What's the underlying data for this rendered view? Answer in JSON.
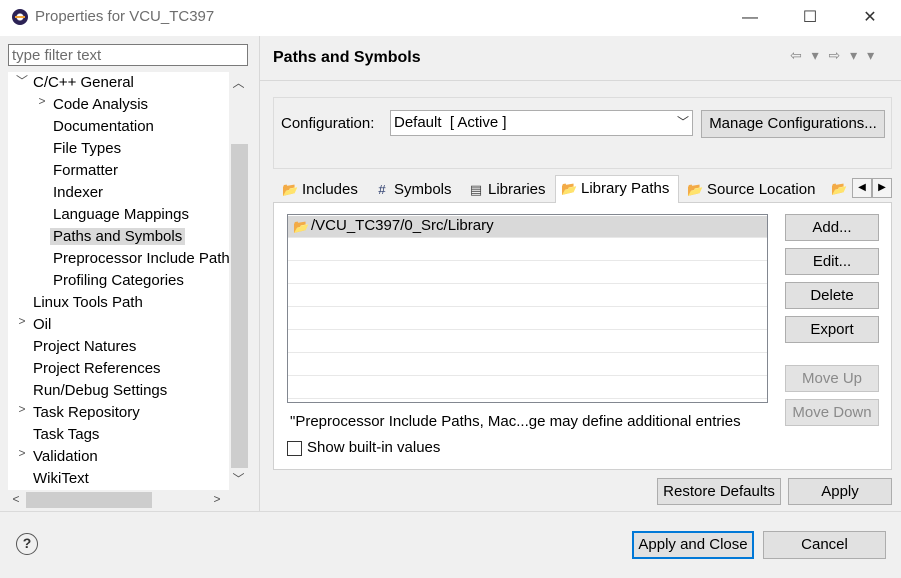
{
  "window": {
    "title": "Properties for VCU_TC397",
    "minimize_icon": "—",
    "maximize_icon": "☐",
    "close_icon": "✕"
  },
  "filter": {
    "placeholder": "type filter text",
    "value": ""
  },
  "tree": {
    "items": [
      {
        "label": "C/C++ General",
        "level": 1,
        "expander": "expanded"
      },
      {
        "label": "Code Analysis",
        "level": 2,
        "expander": "collapsed"
      },
      {
        "label": "Documentation",
        "level": 2,
        "expander": "none"
      },
      {
        "label": "File Types",
        "level": 2,
        "expander": "none"
      },
      {
        "label": "Formatter",
        "level": 2,
        "expander": "none"
      },
      {
        "label": "Indexer",
        "level": 2,
        "expander": "none"
      },
      {
        "label": "Language Mappings",
        "level": 2,
        "expander": "none"
      },
      {
        "label": "Paths and Symbols",
        "level": 2,
        "expander": "none",
        "selected": true
      },
      {
        "label": "Preprocessor Include Path",
        "level": 2,
        "expander": "none"
      },
      {
        "label": "Profiling Categories",
        "level": 2,
        "expander": "none"
      },
      {
        "label": "Linux Tools Path",
        "level": 1,
        "expander": "none"
      },
      {
        "label": "Oil",
        "level": 1,
        "expander": "collapsed"
      },
      {
        "label": "Project Natures",
        "level": 1,
        "expander": "none"
      },
      {
        "label": "Project References",
        "level": 1,
        "expander": "none"
      },
      {
        "label": "Run/Debug Settings",
        "level": 1,
        "expander": "none"
      },
      {
        "label": "Task Repository",
        "level": 1,
        "expander": "collapsed"
      },
      {
        "label": "Task Tags",
        "level": 1,
        "expander": "none"
      },
      {
        "label": "Validation",
        "level": 1,
        "expander": "collapsed"
      },
      {
        "label": "WikiText",
        "level": 1,
        "expander": "none"
      }
    ]
  },
  "page": {
    "title": "Paths and Symbols",
    "nav": "⇦ ▾ ⇨ ▾ ▾"
  },
  "configuration": {
    "label": "Configuration:",
    "value": "Default  [ Active ]",
    "manage_label": "Manage Configurations..."
  },
  "tabs": [
    {
      "label": "Includes",
      "icon": "includes-icon",
      "glyph": "📂",
      "active": false
    },
    {
      "label": "Symbols",
      "icon": "hash-icon",
      "glyph": "#",
      "active": false
    },
    {
      "label": "Libraries",
      "icon": "libraries-icon",
      "glyph": "▤",
      "active": false
    },
    {
      "label": "Library Paths",
      "icon": "folder-icon",
      "glyph": "📂",
      "active": true
    },
    {
      "label": "Source Location",
      "icon": "source-folder-icon",
      "glyph": "📂",
      "active": false
    }
  ],
  "library_paths": {
    "rows": [
      "/VCU_TC397/0_Src/Library"
    ],
    "note": "\"Preprocessor Include Paths, Mac...ge may define additional entries",
    "show_builtin_label": "Show built-in values",
    "show_builtin_checked": false
  },
  "side_buttons": {
    "add": "Add...",
    "edit": "Edit...",
    "delete": "Delete",
    "export": "Export",
    "move_up": "Move Up",
    "move_down": "Move Down"
  },
  "page_buttons": {
    "restore_defaults": "Restore Defaults",
    "apply": "Apply"
  },
  "dialog_buttons": {
    "apply_close": "Apply and Close",
    "cancel": "Cancel",
    "help": "?"
  }
}
